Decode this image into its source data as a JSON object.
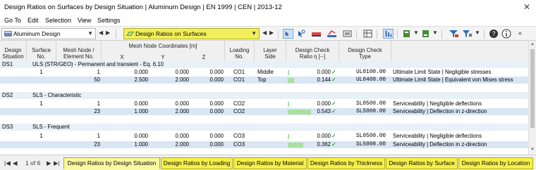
{
  "window": {
    "title": "Design Ratios on Surfaces by Design Situation | Aluminum Design | EN 1999 | CEN | 2013-12",
    "close_glyph": "✕"
  },
  "menu": [
    "Go To",
    "Edit",
    "Selection",
    "View",
    "Settings"
  ],
  "toolbar": {
    "module_select": "Aluminum Design",
    "result_select": "Design Ratios on Surfaces",
    "nav_prev": "◀",
    "nav_next": "▶",
    "dropdown_glyph": "▼",
    "icons": [
      "select-icon",
      "pick-icon",
      "result-scale-icon",
      "color-bar-icon",
      "visibility-icon",
      "table-layout-icon",
      "export-icon",
      "filter-icon",
      "sort-icon",
      "help-icon",
      "info-icon"
    ]
  },
  "columns": {
    "design_situation": "Design\nSituation",
    "surface_no": "Surface\nNo.",
    "mesh_node": "Mesh Node /\nElement No.",
    "coords_group": "Mesh Node Coordinates [m]",
    "x": "X",
    "y": "Y",
    "z": "Z",
    "loading_no": "Loading\nNo.",
    "layer_side": "Layer\nSide",
    "ratio": "Design Check\nRatio η [--]",
    "check_type": "Design Check\nType"
  },
  "groups": [
    {
      "ds": "DS1",
      "label": "ULS (STR/GEO) - Permanent and transient - Eq. 6.10",
      "rows": [
        {
          "surface": "1",
          "node": "1",
          "x": "0.000",
          "y": "0.000",
          "z": "0.000",
          "loading": "CO1",
          "side": "Middle",
          "ratio": "0.000",
          "ratio_value": 0.0,
          "check": "✓",
          "type": "UL0100.00",
          "desc": "Ultimate Limit State | Negligible stresses"
        },
        {
          "surface": "",
          "node": "50",
          "x": "2.500",
          "y": "2.000",
          "z": "0.000",
          "loading": "CO1",
          "side": "Top",
          "ratio": "0.144",
          "ratio_value": 0.144,
          "check": "✓",
          "type": "UL0400.00",
          "desc": "Ultimate Limit State | Equivalent von Mises stress"
        }
      ]
    },
    {
      "ds": "DS2",
      "label": "SLS - Characteristic",
      "rows": [
        {
          "surface": "1",
          "node": "1",
          "x": "0.000",
          "y": "0.000",
          "z": "0.000",
          "loading": "CO2",
          "side": "",
          "ratio": "0.000",
          "ratio_value": 0.0,
          "check": "✓",
          "type": "SL0500.00",
          "desc": "Serviceability | Negligible deflections"
        },
        {
          "surface": "",
          "node": "23",
          "x": "1.000",
          "y": "2.000",
          "z": "0.000",
          "loading": "CO2",
          "side": "",
          "ratio": "0.543",
          "ratio_value": 0.543,
          "check": "✓",
          "type": "SL5000.00",
          "desc": "Serviceability | Deflection in z-direction"
        }
      ]
    },
    {
      "ds": "DS3",
      "label": "SLS - Frequent",
      "rows": [
        {
          "surface": "1",
          "node": "1",
          "x": "0.000",
          "y": "0.000",
          "z": "0.000",
          "loading": "CO3",
          "side": "",
          "ratio": "0.000",
          "ratio_value": 0.0,
          "check": "✓",
          "type": "SL0500.00",
          "desc": "Serviceability | Negligible deflections"
        },
        {
          "surface": "",
          "node": "23",
          "x": "1.000",
          "y": "2.000",
          "z": "0.000",
          "loading": "CO3",
          "side": "",
          "ratio": "0.362",
          "ratio_value": 0.362,
          "check": "✓",
          "type": "SL5000.00",
          "desc": "Serviceability | Deflection in z-direction"
        }
      ]
    }
  ],
  "status": {
    "pager": "1 of 6",
    "first": "|◀",
    "prev": "◀",
    "next": "▶",
    "last": "▶|",
    "tabs": [
      "Design Ratios by Design Situation",
      "Design Ratios by Loading",
      "Design Ratios by Material",
      "Design Ratios by Thickness",
      "Design Ratios by Surface",
      "Design Ratios by Location"
    ],
    "active_tab": 0
  },
  "colors": {
    "accent_yellow": "#f2f05a",
    "ratio_bar": "#a8e0a0",
    "check_green": "#3a9a3a",
    "group_row": "#e8f0f8"
  }
}
